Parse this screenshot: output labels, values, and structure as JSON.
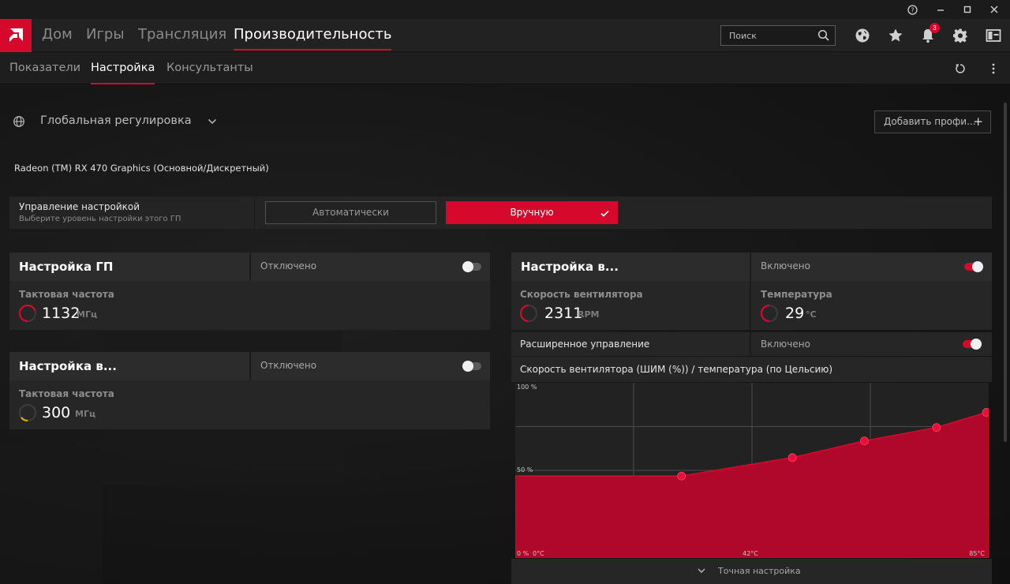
{
  "colors": {
    "accent": "#d6082b",
    "panel": "#262626",
    "header": "#2c2c2c",
    "text_dim": "#8e8e8e"
  },
  "titlebar": {
    "help_icon": "question-circle-icon",
    "minimize_icon": "minimize-icon",
    "maximize_icon": "maximize-icon",
    "close_icon": "close-icon"
  },
  "nav": {
    "logo_icon": "amd-logo-icon",
    "items": [
      "Дом",
      "Игры",
      "Трансляция",
      "Производительность"
    ],
    "active_index": 3,
    "search_placeholder": "Поиск",
    "notifications_count": "3",
    "right_icons": [
      "globe-icon",
      "star-icon",
      "bell-icon",
      "gear-icon",
      "sidebar-toggle-icon"
    ]
  },
  "subnav": {
    "items": [
      "Показатели",
      "Настройка",
      "Консультанты"
    ],
    "active_index": 1,
    "right_icons": [
      "reset-icon",
      "more-vertical-icon"
    ]
  },
  "profile": {
    "label": "Глобальная регулировка",
    "add_profile_label": "Добавить профи..."
  },
  "gpu_name": "Radeon (TM) RX 470 Graphics (Основной/Дискретный)",
  "tuning_control": {
    "title": "Управление настройкой",
    "subtitle": "Выберите уровень настройки этого ГП",
    "auto_label": "Автоматически",
    "manual_label": "Вручную",
    "selected": "manual"
  },
  "gpu_tuning": {
    "title": "Настройка ГП",
    "status": "Отключено",
    "enabled": false,
    "clock_label": "Тактовая частота",
    "clock_value": "1132",
    "clock_unit": "МГц",
    "gauge_color": "#d6082b",
    "gauge_level": 0.7
  },
  "vram_tuning": {
    "title": "Настройка в...",
    "status": "Отключено",
    "enabled": false,
    "clock_label": "Тактовая частота",
    "clock_value": "300",
    "clock_unit": "МГц",
    "gauge_color": "#e0b000",
    "gauge_level": 0.15
  },
  "fan_tuning": {
    "title": "Настройка в...",
    "status": "Включено",
    "enabled": true,
    "fan_speed_label": "Скорость вентилятора",
    "fan_speed_value": "2311",
    "fan_speed_unit": "RPM",
    "temp_label": "Температура",
    "temp_value": "29",
    "temp_unit": "°C",
    "advanced_label": "Расширенное управление",
    "advanced_status": "Включено",
    "advanced_enabled": true,
    "curve_title": "Скорость вентилятора (ШИМ (%)) / температура (по Цельсию)",
    "fine_tune_label": "Точная настройка"
  },
  "chart_data": {
    "type": "area",
    "title": "",
    "y_tick_labels": [
      "100 %",
      "50 %",
      "0 %"
    ],
    "x_tick_labels": [
      "0°C",
      "42°C",
      "85°C"
    ],
    "xlim": [
      0,
      85
    ],
    "ylim": [
      0,
      100
    ],
    "grid": true,
    "series": [
      {
        "points": [
          {
            "x": 0,
            "y": 49
          },
          {
            "x": 30,
            "y": 49
          },
          {
            "x": 50,
            "y": 60
          },
          {
            "x": 63,
            "y": 70
          },
          {
            "x": 76,
            "y": 78
          },
          {
            "x": 85,
            "y": 87
          }
        ]
      }
    ]
  }
}
